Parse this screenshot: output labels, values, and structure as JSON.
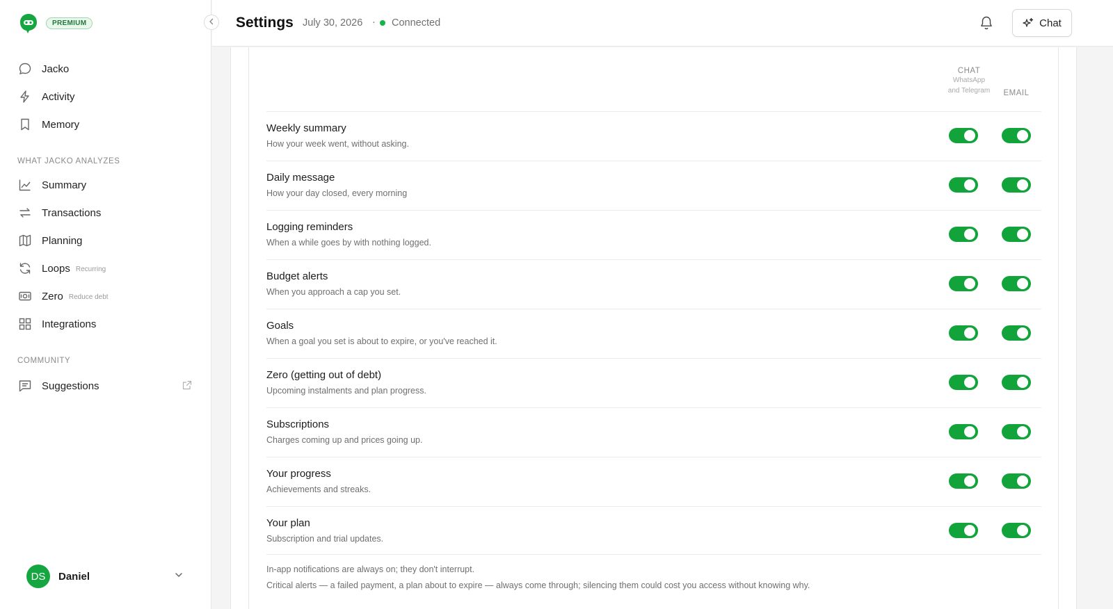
{
  "sidebar": {
    "badge": "PREMIUM",
    "nav": [
      {
        "label": "Jacko",
        "icon": "chat-bubble-icon"
      },
      {
        "label": "Activity",
        "icon": "lightning-icon"
      },
      {
        "label": "Memory",
        "icon": "bookmark-icon"
      }
    ],
    "section_analyze": "WHAT JACKO ANALYZES",
    "analyze": [
      {
        "label": "Summary",
        "icon": "line-chart-icon",
        "sub": ""
      },
      {
        "label": "Transactions",
        "icon": "arrows-swap-icon",
        "sub": ""
      },
      {
        "label": "Planning",
        "icon": "map-icon",
        "sub": ""
      },
      {
        "label": "Loops",
        "icon": "refresh-icon",
        "sub": "Recurring"
      },
      {
        "label": "Zero",
        "icon": "banknote-icon",
        "sub": "Reduce debt"
      },
      {
        "label": "Integrations",
        "icon": "grid-plus-icon",
        "sub": ""
      }
    ],
    "section_community": "COMMUNITY",
    "community": [
      {
        "label": "Suggestions",
        "icon": "message-lines-icon"
      }
    ],
    "user": {
      "initials": "DS",
      "name": "Daniel"
    }
  },
  "header": {
    "title": "Settings",
    "date": "July 30, 2026",
    "separator": "·",
    "status": "Connected",
    "chat_label": "Chat"
  },
  "columns": {
    "chat": {
      "label": "CHAT",
      "sub1": "WhatsApp",
      "sub2": "and Telegram"
    },
    "email": {
      "label": "EMAIL"
    }
  },
  "notifications": [
    {
      "title": "Weekly summary",
      "desc": "How your week went, without asking.",
      "chat": true,
      "email": true
    },
    {
      "title": "Daily message",
      "desc": "How your day closed, every morning",
      "chat": true,
      "email": true
    },
    {
      "title": "Logging reminders",
      "desc": "When a while goes by with nothing logged.",
      "chat": true,
      "email": true
    },
    {
      "title": "Budget alerts",
      "desc": "When you approach a cap you set.",
      "chat": true,
      "email": true
    },
    {
      "title": "Goals",
      "desc": "When a goal you set is about to expire, or you've reached it.",
      "chat": true,
      "email": true
    },
    {
      "title": "Zero (getting out of debt)",
      "desc": "Upcoming instalments and plan progress.",
      "chat": true,
      "email": true
    },
    {
      "title": "Subscriptions",
      "desc": "Charges coming up and prices going up.",
      "chat": true,
      "email": true
    },
    {
      "title": "Your progress",
      "desc": "Achievements and streaks.",
      "chat": true,
      "email": true
    },
    {
      "title": "Your plan",
      "desc": "Subscription and trial updates.",
      "chat": true,
      "email": true
    }
  ],
  "footer": {
    "note1": "In-app notifications are always on; they don't interrupt.",
    "note2": "Critical alerts — a failed payment, a plan about to expire — always come through; silencing them could cost you access without knowing why."
  },
  "colors": {
    "accent": "#12a33b",
    "status": "#15b34a"
  }
}
